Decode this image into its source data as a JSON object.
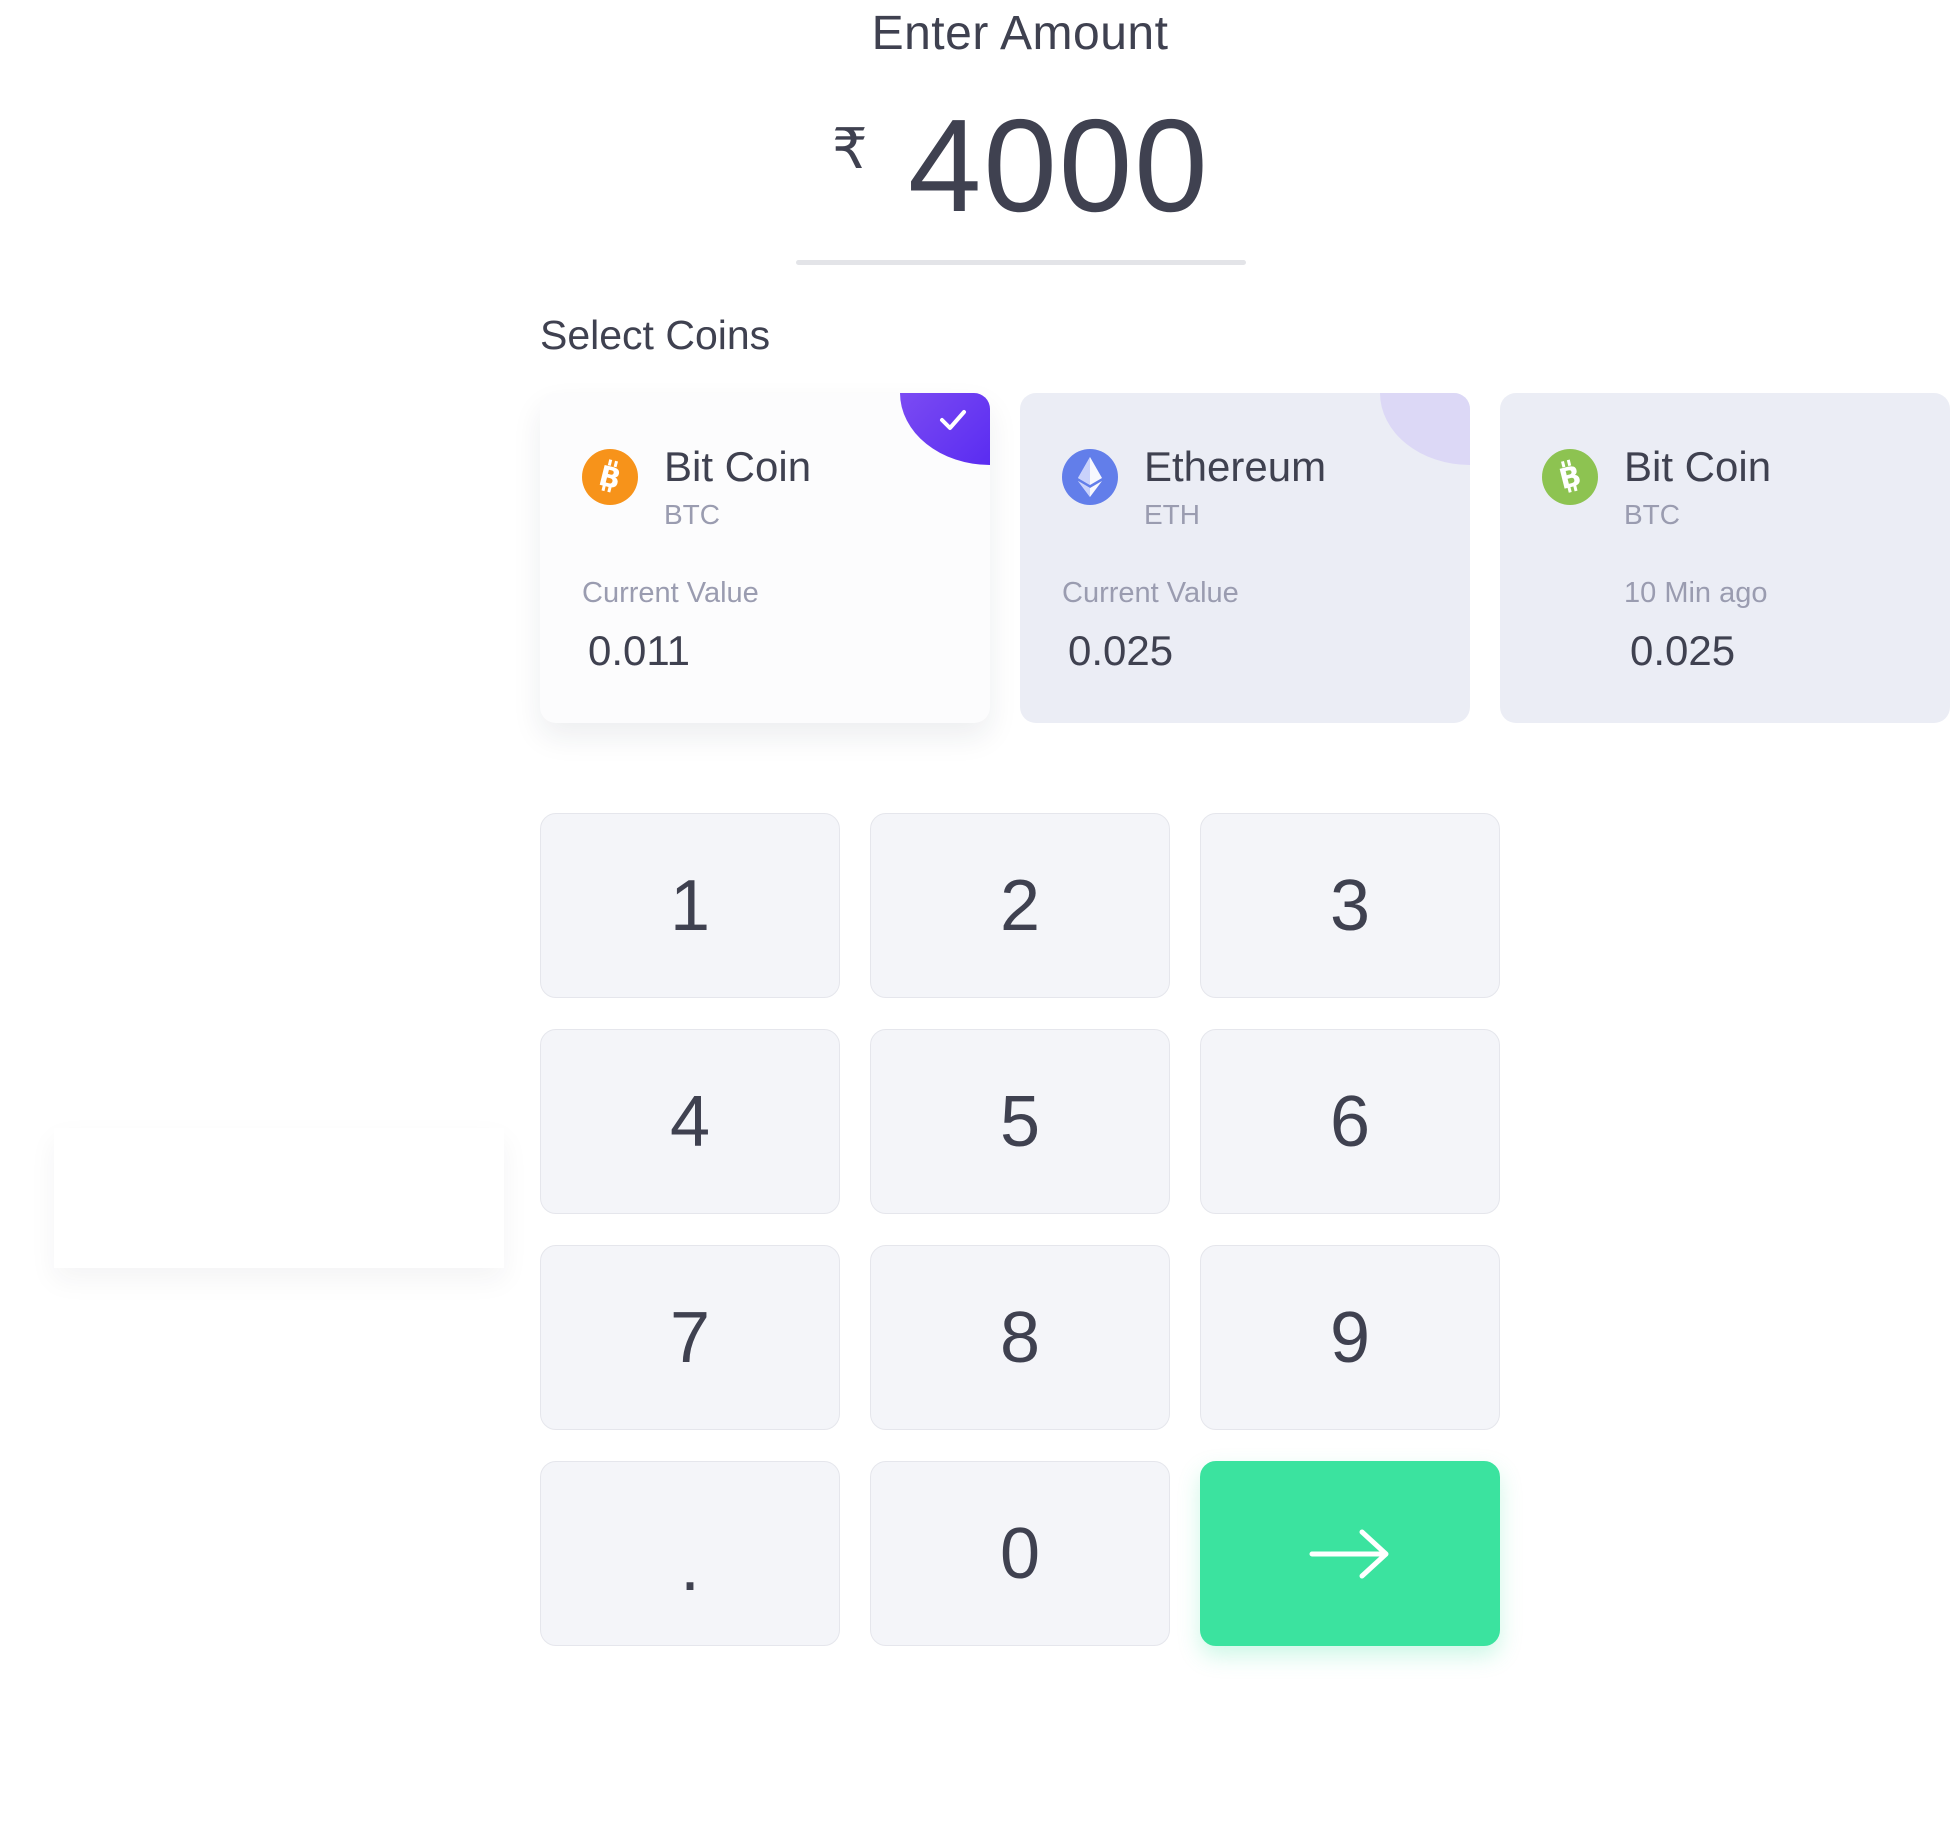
{
  "title": "Enter Amount",
  "amount": {
    "currency_symbol": "₹",
    "value": "4000"
  },
  "coins_section": {
    "label": "Select Coins",
    "coins": [
      {
        "name": "Bit Coin",
        "symbol": "BTC",
        "meta_label": "Current Value",
        "value": "0.011",
        "icon": "bitcoin-icon",
        "icon_color": "#f7931a",
        "selected": true
      },
      {
        "name": "Ethereum",
        "symbol": "ETH",
        "meta_label": "Current Value",
        "value": "0.025",
        "icon": "ethereum-icon",
        "icon_color": "#627eea",
        "selected": false
      },
      {
        "name": "Bit Coin",
        "symbol": "BTC",
        "meta_label": "10 Min ago",
        "value": "0.025",
        "icon": "bitcoin-icon",
        "icon_color": "#8dc351",
        "selected": false
      }
    ]
  },
  "keypad": {
    "keys": [
      "1",
      "2",
      "3",
      "4",
      "5",
      "6",
      "7",
      "8",
      "9",
      ".",
      "0"
    ],
    "submit_icon": "arrow-right-icon",
    "submit_color": "#3be39f"
  },
  "colors": {
    "accent": "#5a2cf1",
    "text": "#3f4150",
    "muted": "#9a9cb0",
    "card_bg": "#ebedf5"
  }
}
